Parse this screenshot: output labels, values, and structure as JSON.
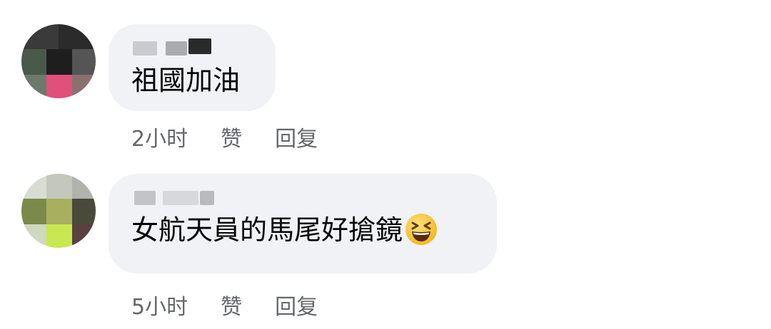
{
  "comments": [
    {
      "text": "祖國加油",
      "time": "2小时",
      "like_label": "赞",
      "reply_label": "回复",
      "avatar": "blurred-avatar"
    },
    {
      "text": "女航天員的馬尾好搶鏡",
      "emoji": "grinning-squinting-face-icon",
      "time": "5小时",
      "like_label": "赞",
      "reply_label": "回复",
      "avatar": "blurred-avatar"
    }
  ]
}
